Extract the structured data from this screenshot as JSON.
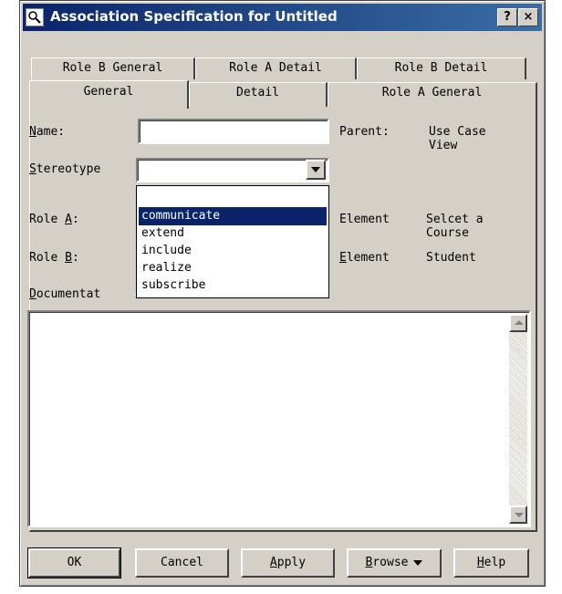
{
  "window": {
    "title": "Association Specification for Untitled",
    "help_glyph": "?",
    "close_glyph": "×"
  },
  "tabs": {
    "row1": [
      "Role B General",
      "Role A Detail",
      "Role B Detail"
    ],
    "row2": [
      "General",
      "Detail",
      "Role A General"
    ],
    "selected": "General"
  },
  "form": {
    "name_label_key": "N",
    "name_label_rest": "ame:",
    "name_value": "",
    "parent_label": "Parent:",
    "parent_value_line1": "Use Case",
    "parent_value_line2": "View",
    "stereotype_label_key": "S",
    "stereotype_label_rest": "tereotype",
    "stereotype_value": "",
    "role_a_label_pre": "Role ",
    "role_a_label_key": "A",
    "role_a_label_post": ":",
    "role_a_element_label": "Element",
    "role_a_element_value_line1": "Selcet a",
    "role_a_element_value_line2": "Course",
    "role_b_label_pre": "Role ",
    "role_b_label_key": "B",
    "role_b_label_post": ":",
    "role_b_element_label_key": "E",
    "role_b_element_label_rest": "lement",
    "role_b_element_value": "Student",
    "documentation_label_key": "D",
    "documentation_label_rest": "ocumentat",
    "documentation_value": ""
  },
  "stereotype_dropdown": {
    "options": [
      "",
      "communicate",
      "extend",
      "include",
      "realize",
      "subscribe"
    ],
    "selected": "communicate"
  },
  "buttons": {
    "ok": "OK",
    "cancel": "Cancel",
    "apply_key": "A",
    "apply_rest": "pply",
    "browse_key": "B",
    "browse_rest": "rowse",
    "help_key": "H",
    "help_rest": "elp"
  },
  "colors": {
    "titlebar_start": "#0a246a",
    "titlebar_end": "#3a6ea5",
    "dialog_face": "#d4d0c8",
    "selection": "#0a246a"
  }
}
